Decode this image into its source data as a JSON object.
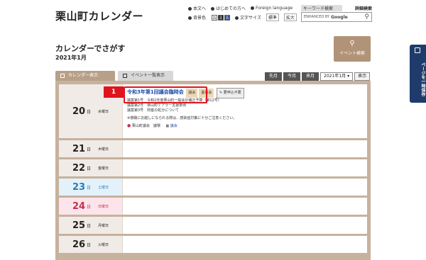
{
  "header": {
    "site_title": "栗山町カレンダー",
    "util": {
      "text_only": "本文へ",
      "first_time": "はじめての方へ",
      "foreign": "Foreign language",
      "bg_color": "背景色",
      "bg_white": "白",
      "bg_black": "黒",
      "bg_blue": "青",
      "font_size": "文字サイズ",
      "font_standard": "標準",
      "font_large": "拡大"
    },
    "search": {
      "keyword_label": "キーワード検索",
      "advanced_label": "詳細検索",
      "enhanced_by": "ENHANCED BY",
      "google": "Google",
      "search_icon": "search-icon"
    }
  },
  "main": {
    "title": "カレンダーでさがす",
    "month": "2021年1月",
    "event_search_label": "イベント検索",
    "tabs": [
      {
        "label": "カレンダー表示",
        "active": true
      },
      {
        "label": "イベント一覧表示",
        "active": false
      }
    ],
    "nav": {
      "prev": "先月",
      "today": "今月",
      "next": "来月",
      "month_select": "2021年1月",
      "show": "表示"
    },
    "days": [
      {
        "num": "20",
        "unit": "日",
        "weekday": "水曜日",
        "type": "weekday"
      },
      {
        "num": "21",
        "unit": "日",
        "weekday": "木曜日",
        "type": "weekday"
      },
      {
        "num": "22",
        "unit": "日",
        "weekday": "金曜日",
        "type": "weekday"
      },
      {
        "num": "23",
        "unit": "日",
        "weekday": "土曜日",
        "type": "sat"
      },
      {
        "num": "24",
        "unit": "日",
        "weekday": "日曜日",
        "type": "sun"
      },
      {
        "num": "25",
        "unit": "日",
        "weekday": "月曜日",
        "type": "weekday"
      },
      {
        "num": "26",
        "unit": "日",
        "weekday": "火曜日",
        "type": "weekday"
      }
    ],
    "event": {
      "title": "令和3年第1回議会臨時会",
      "tag1": "議会",
      "tag2": "委員会",
      "tag3": "要申込不要",
      "line1": "議案第1号　令和2年度栗山町一般会計補正予算（第12号）",
      "line2": "議案第2号　栗山町ケアラー支援条例",
      "line3": "議案第3号　財産の処分について",
      "note": "※傍聴にお越しになられる際は、感染症対策に十分ご注意ください。",
      "place": "栗山町議会　議場",
      "link": "議会"
    },
    "annotation": "1"
  },
  "side": {
    "save_label": "ページを一時保存"
  },
  "colors": {
    "frame": "#c7b29d",
    "highlight": "#e0141e",
    "side_tab": "#1f3b6b"
  }
}
